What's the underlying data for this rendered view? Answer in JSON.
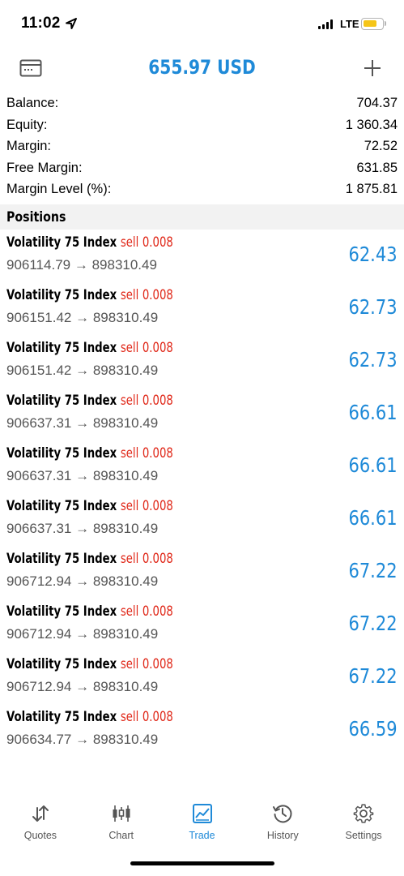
{
  "status_bar": {
    "time": "11:02",
    "network": "LTE",
    "icons": [
      "location-arrow-icon",
      "signal-icon",
      "battery-icon"
    ],
    "battery_color": "#f5c518"
  },
  "header": {
    "title": "655.97 USD",
    "left_icon": "wallet-icon",
    "right_icon": "plus-icon"
  },
  "summary": [
    {
      "label": "Balance:",
      "value": "704.37"
    },
    {
      "label": "Equity:",
      "value": "1 360.34"
    },
    {
      "label": "Margin:",
      "value": "72.52"
    },
    {
      "label": "Free Margin:",
      "value": "631.85"
    },
    {
      "label": "Margin Level (%):",
      "value": "1 875.81"
    }
  ],
  "positions_title": "Positions",
  "positions": [
    {
      "symbol": "Volatility 75 Index",
      "type": "sell",
      "volume": "0.008",
      "open": "906114.79",
      "current": "898310.49",
      "profit": "62.43"
    },
    {
      "symbol": "Volatility 75 Index",
      "type": "sell",
      "volume": "0.008",
      "open": "906151.42",
      "current": "898310.49",
      "profit": "62.73"
    },
    {
      "symbol": "Volatility 75 Index",
      "type": "sell",
      "volume": "0.008",
      "open": "906151.42",
      "current": "898310.49",
      "profit": "62.73"
    },
    {
      "symbol": "Volatility 75 Index",
      "type": "sell",
      "volume": "0.008",
      "open": "906637.31",
      "current": "898310.49",
      "profit": "66.61"
    },
    {
      "symbol": "Volatility 75 Index",
      "type": "sell",
      "volume": "0.008",
      "open": "906637.31",
      "current": "898310.49",
      "profit": "66.61"
    },
    {
      "symbol": "Volatility 75 Index",
      "type": "sell",
      "volume": "0.008",
      "open": "906637.31",
      "current": "898310.49",
      "profit": "66.61"
    },
    {
      "symbol": "Volatility 75 Index",
      "type": "sell",
      "volume": "0.008",
      "open": "906712.94",
      "current": "898310.49",
      "profit": "67.22"
    },
    {
      "symbol": "Volatility 75 Index",
      "type": "sell",
      "volume": "0.008",
      "open": "906712.94",
      "current": "898310.49",
      "profit": "67.22"
    },
    {
      "symbol": "Volatility 75 Index",
      "type": "sell",
      "volume": "0.008",
      "open": "906712.94",
      "current": "898310.49",
      "profit": "67.22"
    },
    {
      "symbol": "Volatility 75 Index",
      "type": "sell",
      "volume": "0.008",
      "open": "906634.77",
      "current": "898310.49",
      "profit": "66.59"
    }
  ],
  "tabs": [
    {
      "label": "Quotes",
      "icon": "quotes-icon",
      "active": false
    },
    {
      "label": "Chart",
      "icon": "candlestick-chart-icon",
      "active": false
    },
    {
      "label": "Trade",
      "icon": "trade-chart-icon",
      "active": true
    },
    {
      "label": "History",
      "icon": "history-icon",
      "active": false
    },
    {
      "label": "Settings",
      "icon": "gear-icon",
      "active": false
    }
  ],
  "colors": {
    "accent": "#1f8ad8",
    "sell": "#e0291a",
    "section_bg": "#f2f2f2"
  }
}
